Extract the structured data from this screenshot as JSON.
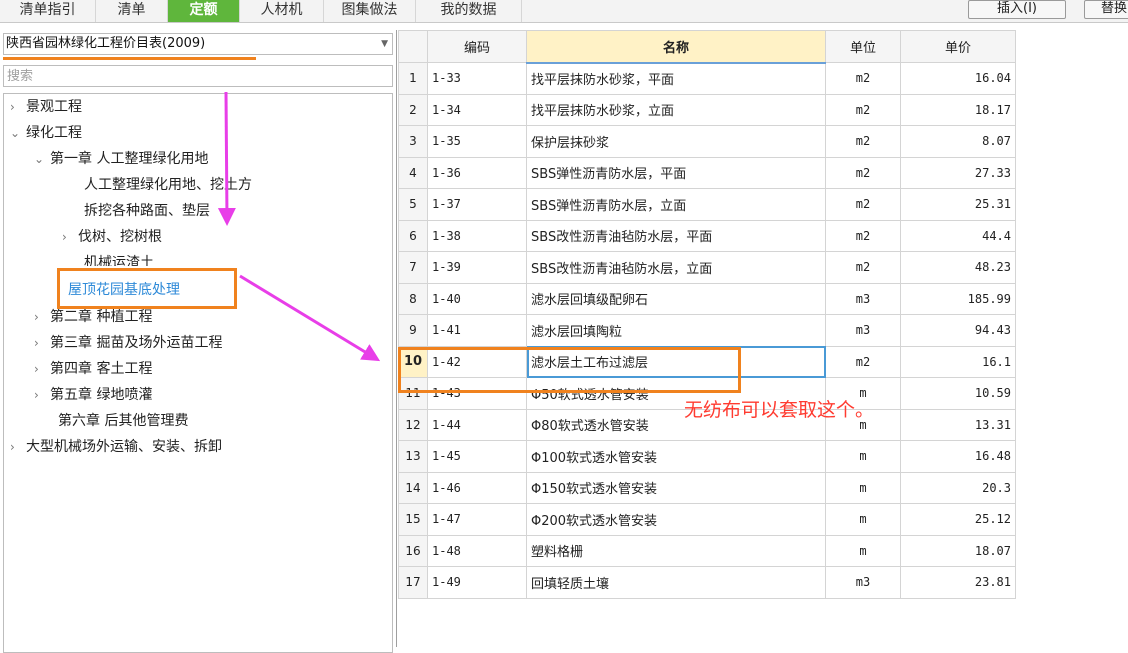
{
  "tabs": [
    "清单指引",
    "清单",
    "定额",
    "人材机",
    "图集做法",
    "我的数据"
  ],
  "active_tab": "定额",
  "toolbar": {
    "insert_label": "插入(I)",
    "replace_label": "替换"
  },
  "library": {
    "selected": "陕西省园林绿化工程价目表(2009)"
  },
  "search": {
    "placeholder": "搜索",
    "value": ""
  },
  "tree": {
    "landscape": "景观工程",
    "greening": "绿化工程",
    "ch1": "第一章 人工整理绿化用地",
    "ch1_a": "人工整理绿化用地、挖土方",
    "ch1_b": "拆挖各种路面、垫层",
    "ch1_c": "伐树、挖树根",
    "ch1_d": "机械运渣土",
    "ch1_e": "屋顶花园基底处理",
    "ch2": "第二章 种植工程",
    "ch3": "第三章 掘苗及场外运苗工程",
    "ch4": "第四章 客土工程",
    "ch5": "第五章 绿地喷灌",
    "ch6": "第六章 后其他管理费",
    "machinery": "大型机械场外运输、安装、拆卸"
  },
  "grid": {
    "headers": {
      "code": "编码",
      "name": "名称",
      "unit": "单位",
      "price": "单价"
    },
    "rows": [
      {
        "n": "1",
        "code": "1-33",
        "name": "找平层抹防水砂浆，平面",
        "unit": "m2",
        "price": "16.04"
      },
      {
        "n": "2",
        "code": "1-34",
        "name": "找平层抹防水砂浆，立面",
        "unit": "m2",
        "price": "18.17"
      },
      {
        "n": "3",
        "code": "1-35",
        "name": "保护层抹砂浆",
        "unit": "m2",
        "price": "8.07"
      },
      {
        "n": "4",
        "code": "1-36",
        "name": "SBS弹性沥青防水层，平面",
        "unit": "m2",
        "price": "27.33"
      },
      {
        "n": "5",
        "code": "1-37",
        "name": "SBS弹性沥青防水层，立面",
        "unit": "m2",
        "price": "25.31"
      },
      {
        "n": "6",
        "code": "1-38",
        "name": "SBS改性沥青油毡防水层，平面",
        "unit": "m2",
        "price": "44.4"
      },
      {
        "n": "7",
        "code": "1-39",
        "name": "SBS改性沥青油毡防水层，立面",
        "unit": "m2",
        "price": "48.23"
      },
      {
        "n": "8",
        "code": "1-40",
        "name": "滤水层回填级配卵石",
        "unit": "m3",
        "price": "185.99"
      },
      {
        "n": "9",
        "code": "1-41",
        "name": "滤水层回填陶粒",
        "unit": "m3",
        "price": "94.43"
      },
      {
        "n": "10",
        "code": "1-42",
        "name": "滤水层土工布过滤层",
        "unit": "m2",
        "price": "16.1"
      },
      {
        "n": "11",
        "code": "1-43",
        "name": "Φ50软式透水管安装",
        "unit": "m",
        "price": "10.59"
      },
      {
        "n": "12",
        "code": "1-44",
        "name": "Φ80软式透水管安装",
        "unit": "m",
        "price": "13.31"
      },
      {
        "n": "13",
        "code": "1-45",
        "name": "Φ100软式透水管安装",
        "unit": "m",
        "price": "16.48"
      },
      {
        "n": "14",
        "code": "1-46",
        "name": "Φ150软式透水管安装",
        "unit": "m",
        "price": "20.3"
      },
      {
        "n": "15",
        "code": "1-47",
        "name": "Φ200软式透水管安装",
        "unit": "m",
        "price": "25.12"
      },
      {
        "n": "16",
        "code": "1-48",
        "name": "塑料格栅",
        "unit": "m",
        "price": "18.07"
      },
      {
        "n": "17",
        "code": "1-49",
        "name": "回填轻质土壤",
        "unit": "m3",
        "price": "23.81"
      }
    ]
  },
  "annotation": {
    "text": "无纺布可以套取这个。"
  },
  "colors": {
    "active_tab": "#5fb63c",
    "annotation_box": "#f0821e",
    "annotation_text": "#ff3b30",
    "arrow": "#e83ee8",
    "tree_selected": "#2e8ad8"
  }
}
